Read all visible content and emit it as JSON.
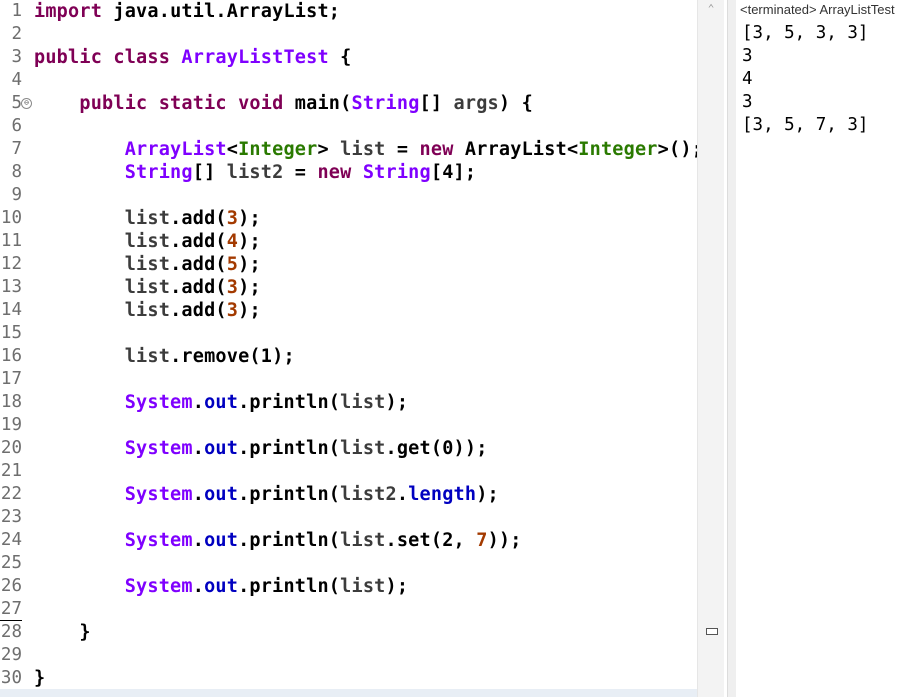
{
  "editor": {
    "line_numbers": [
      "1",
      "2",
      "3",
      "4",
      "5",
      "6",
      "7",
      "8",
      "9",
      "10",
      "11",
      "12",
      "13",
      "14",
      "15",
      "16",
      "17",
      "18",
      "19",
      "20",
      "21",
      "22",
      "23",
      "24",
      "25",
      "26",
      "27",
      "28",
      "29",
      "30"
    ],
    "lines": [
      {
        "segments": [
          {
            "t": "import ",
            "c": "kw"
          },
          {
            "t": "java.util.ArrayList;",
            "c": "c-dark"
          }
        ]
      },
      {
        "segments": []
      },
      {
        "segments": [
          {
            "t": "public ",
            "c": "kw"
          },
          {
            "t": "class ",
            "c": "kw"
          },
          {
            "t": "ArrayListTest",
            "c": "c-purple"
          },
          {
            "t": " {",
            "c": "c-dark"
          }
        ]
      },
      {
        "segments": []
      },
      {
        "segments": [
          {
            "t": "    public ",
            "c": "kw"
          },
          {
            "t": "static ",
            "c": "kw"
          },
          {
            "t": "void ",
            "c": "kw"
          },
          {
            "t": "main(",
            "c": "c-dark"
          },
          {
            "t": "String",
            "c": "c-purple"
          },
          {
            "t": "[] ",
            "c": "c-dark"
          },
          {
            "t": "args",
            "c": "c-var"
          },
          {
            "t": ") {",
            "c": "c-dark"
          }
        ]
      },
      {
        "segments": []
      },
      {
        "segments": [
          {
            "t": "        ArrayList",
            "c": "c-purple"
          },
          {
            "t": "<",
            "c": "c-dark"
          },
          {
            "t": "Integer",
            "c": "c-green"
          },
          {
            "t": "> ",
            "c": "c-dark"
          },
          {
            "t": "list",
            "c": "c-var"
          },
          {
            "t": " = ",
            "c": "c-dark"
          },
          {
            "t": "new ",
            "c": "kw"
          },
          {
            "t": "ArrayList",
            "c": "c-dark"
          },
          {
            "t": "<",
            "c": "c-dark"
          },
          {
            "t": "Integer",
            "c": "c-green"
          },
          {
            "t": ">();",
            "c": "c-dark"
          }
        ]
      },
      {
        "segments": [
          {
            "t": "        String",
            "c": "c-purple"
          },
          {
            "t": "[] ",
            "c": "c-dark"
          },
          {
            "t": "list2",
            "c": "c-var"
          },
          {
            "t": " = ",
            "c": "c-dark"
          },
          {
            "t": "new ",
            "c": "kw"
          },
          {
            "t": "String",
            "c": "c-purple"
          },
          {
            "t": "[4];",
            "c": "c-dark"
          }
        ]
      },
      {
        "segments": []
      },
      {
        "segments": [
          {
            "t": "        list",
            "c": "c-var"
          },
          {
            "t": ".add(",
            "c": "c-dark"
          },
          {
            "t": "3",
            "c": "c-num"
          },
          {
            "t": ");",
            "c": "c-dark"
          }
        ]
      },
      {
        "segments": [
          {
            "t": "        list",
            "c": "c-var"
          },
          {
            "t": ".add(",
            "c": "c-dark"
          },
          {
            "t": "4",
            "c": "c-num"
          },
          {
            "t": ");",
            "c": "c-dark"
          }
        ]
      },
      {
        "segments": [
          {
            "t": "        list",
            "c": "c-var"
          },
          {
            "t": ".add(",
            "c": "c-dark"
          },
          {
            "t": "5",
            "c": "c-num"
          },
          {
            "t": ");",
            "c": "c-dark"
          }
        ]
      },
      {
        "segments": [
          {
            "t": "        list",
            "c": "c-var"
          },
          {
            "t": ".add(",
            "c": "c-dark"
          },
          {
            "t": "3",
            "c": "c-num"
          },
          {
            "t": ");",
            "c": "c-dark"
          }
        ]
      },
      {
        "segments": [
          {
            "t": "        list",
            "c": "c-var"
          },
          {
            "t": ".add(",
            "c": "c-dark"
          },
          {
            "t": "3",
            "c": "c-num"
          },
          {
            "t": ");",
            "c": "c-dark"
          }
        ]
      },
      {
        "segments": []
      },
      {
        "segments": [
          {
            "t": "        list",
            "c": "c-var"
          },
          {
            "t": ".remove(1);",
            "c": "c-dark"
          }
        ]
      },
      {
        "segments": []
      },
      {
        "segments": [
          {
            "t": "        System",
            "c": "c-purple"
          },
          {
            "t": ".",
            "c": "c-dark"
          },
          {
            "t": "out",
            "c": "c-blue"
          },
          {
            "t": ".println(",
            "c": "c-dark"
          },
          {
            "t": "list",
            "c": "c-var"
          },
          {
            "t": ");",
            "c": "c-dark"
          }
        ]
      },
      {
        "segments": []
      },
      {
        "segments": [
          {
            "t": "        System",
            "c": "c-purple"
          },
          {
            "t": ".",
            "c": "c-dark"
          },
          {
            "t": "out",
            "c": "c-blue"
          },
          {
            "t": ".println(",
            "c": "c-dark"
          },
          {
            "t": "list",
            "c": "c-var"
          },
          {
            "t": ".get(0));",
            "c": "c-dark"
          }
        ]
      },
      {
        "segments": []
      },
      {
        "segments": [
          {
            "t": "        System",
            "c": "c-purple"
          },
          {
            "t": ".",
            "c": "c-dark"
          },
          {
            "t": "out",
            "c": "c-blue"
          },
          {
            "t": ".println(",
            "c": "c-dark"
          },
          {
            "t": "list2",
            "c": "c-var"
          },
          {
            "t": ".",
            "c": "c-dark"
          },
          {
            "t": "length",
            "c": "c-blue"
          },
          {
            "t": ");",
            "c": "c-dark"
          }
        ]
      },
      {
        "segments": []
      },
      {
        "segments": [
          {
            "t": "        System",
            "c": "c-purple"
          },
          {
            "t": ".",
            "c": "c-dark"
          },
          {
            "t": "out",
            "c": "c-blue"
          },
          {
            "t": ".println(",
            "c": "c-dark"
          },
          {
            "t": "list",
            "c": "c-var"
          },
          {
            "t": ".set(2, ",
            "c": "c-dark"
          },
          {
            "t": "7",
            "c": "c-num"
          },
          {
            "t": "));",
            "c": "c-dark"
          }
        ]
      },
      {
        "segments": []
      },
      {
        "segments": [
          {
            "t": "        System",
            "c": "c-purple"
          },
          {
            "t": ".",
            "c": "c-dark"
          },
          {
            "t": "out",
            "c": "c-blue"
          },
          {
            "t": ".println(",
            "c": "c-dark"
          },
          {
            "t": "list",
            "c": "c-var"
          },
          {
            "t": ");",
            "c": "c-dark"
          }
        ]
      },
      {
        "segments": []
      },
      {
        "segments": [
          {
            "t": "    }",
            "c": "c-dark"
          }
        ]
      },
      {
        "segments": []
      },
      {
        "segments": [
          {
            "t": "}",
            "c": "c-dark"
          }
        ]
      }
    ],
    "fold_marker_symbol": "⊖",
    "scroll_up_symbol": "⌃"
  },
  "console": {
    "header": "<terminated> ArrayListTest",
    "output": [
      "[3, 5, 3, 3]",
      "3",
      "4",
      "3",
      "[3, 5, 7, 3]"
    ]
  },
  "colors": {
    "keyword": "#7f0055",
    "type": "#7f00ff",
    "generic": "#2a7a00",
    "field": "#0000c0",
    "number": "#a33a00"
  }
}
